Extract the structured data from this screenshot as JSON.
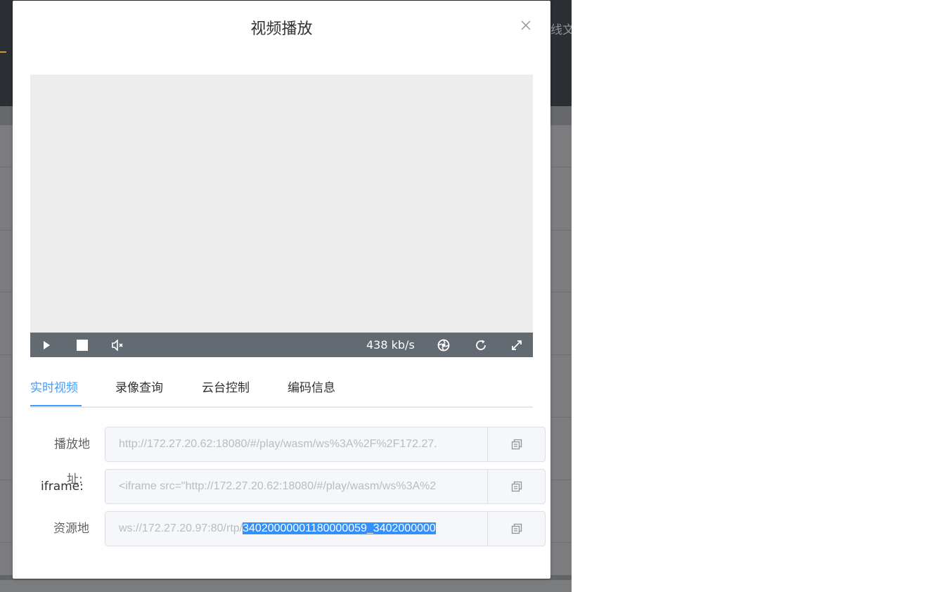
{
  "background": {
    "topbar_text": "线文"
  },
  "dialog": {
    "title": "视频播放",
    "close_icon": "close-icon"
  },
  "player": {
    "bitrate": "438 kb/s",
    "controls": [
      "play-icon",
      "stop-icon",
      "mute-icon",
      "screenshot-icon",
      "refresh-icon",
      "fullscreen-icon"
    ]
  },
  "tabs": [
    {
      "label": "实时视频",
      "active": true
    },
    {
      "label": "录像查询",
      "active": false
    },
    {
      "label": "云台控制",
      "active": false
    },
    {
      "label": "编码信息",
      "active": false
    }
  ],
  "form": {
    "play_address": {
      "label": "播放地",
      "label_wrap": "址:",
      "value": "http://172.27.20.62:18080/#/play/wasm/ws%3A%2F%2F172.27."
    },
    "iframe": {
      "label": "iframe:",
      "value": "<iframe src=\"http://172.27.20.62:18080/#/play/wasm/ws%3A%2"
    },
    "resource_address": {
      "label": "资源地",
      "value_prefix": "ws://172.27.20.97:80/rtp/",
      "value_selected": "34020000001180000059_3402000000"
    }
  },
  "colors": {
    "accent": "#409eff",
    "control_bar": "#646a72",
    "selection": "#3391ff"
  }
}
